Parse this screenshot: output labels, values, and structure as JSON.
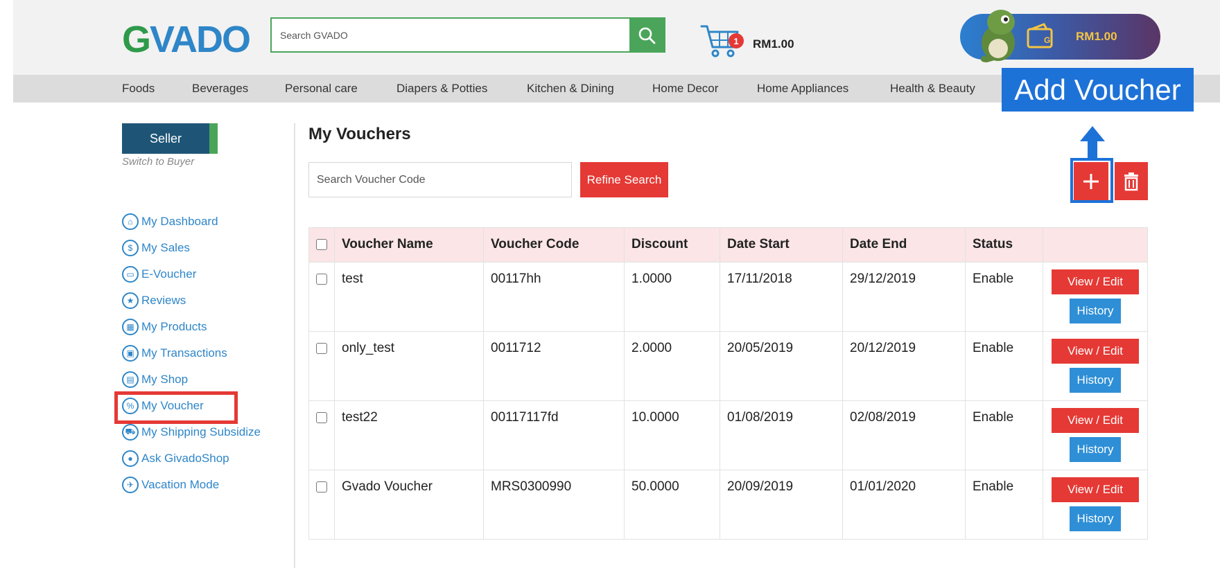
{
  "header": {
    "logo": {
      "first": "G",
      "rest": "VADO"
    },
    "search_placeholder": "Search GVADO",
    "cart": {
      "count": "1",
      "total": "RM1.00"
    },
    "wallet": {
      "amount": "RM1.00"
    },
    "annotation": "Add Voucher"
  },
  "nav": [
    "Foods",
    "Beverages",
    "Personal care",
    "Diapers & Potties",
    "Kitchen & Dining",
    "Home Decor",
    "Home Appliances",
    "Health & Beauty"
  ],
  "sidebar": {
    "seller_label": "Seller",
    "switch_label": "Switch to Buyer",
    "items": [
      {
        "label": "My Dashboard",
        "icon": "home-icon"
      },
      {
        "label": "My Sales",
        "icon": "dollar-icon"
      },
      {
        "label": "E-Voucher",
        "icon": "ticket-icon"
      },
      {
        "label": "Reviews",
        "icon": "star-icon"
      },
      {
        "label": "My Products",
        "icon": "grid-icon"
      },
      {
        "label": "My Transactions",
        "icon": "wallet-icon"
      },
      {
        "label": "My Shop",
        "icon": "shop-icon"
      },
      {
        "label": "My Voucher",
        "icon": "voucher-icon"
      },
      {
        "label": "My Shipping Subsidize",
        "icon": "shipping-icon"
      },
      {
        "label": "Ask GivadoShop",
        "icon": "chat-icon"
      },
      {
        "label": "Vacation Mode",
        "icon": "plane-icon"
      }
    ]
  },
  "main": {
    "title": "My Vouchers",
    "search_placeholder": "Search Voucher Code",
    "refine_label": "Refine Search",
    "columns": [
      "Voucher Name",
      "Voucher Code",
      "Discount",
      "Date Start",
      "Date End",
      "Status"
    ],
    "rows": [
      {
        "name": "test",
        "code": "00117hh",
        "discount": "1.0000",
        "start": "17/11/2018",
        "end": "29/12/2019",
        "status": "Enable"
      },
      {
        "name": "only_test",
        "code": "0011712",
        "discount": "2.0000",
        "start": "20/05/2019",
        "end": "20/12/2019",
        "status": "Enable"
      },
      {
        "name": "test22",
        "code": "00117117fd",
        "discount": "10.0000",
        "start": "01/08/2019",
        "end": "02/08/2019",
        "status": "Enable"
      },
      {
        "name": "Gvado Voucher",
        "code": "MRS0300990",
        "discount": "50.0000",
        "start": "20/09/2019",
        "end": "01/01/2020",
        "status": "Enable"
      }
    ],
    "edit_label": "View / Edit",
    "history_label": "History"
  },
  "colors": {
    "brand_green": "#4aa55a",
    "brand_blue": "#2e86c8",
    "accent_red": "#e53935",
    "annotation_blue": "#1d72d8"
  }
}
